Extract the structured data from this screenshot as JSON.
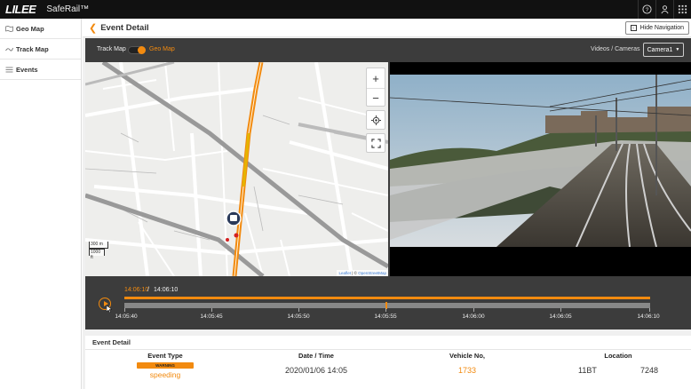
{
  "app": {
    "logo": "LILEE",
    "name": "SafeRail™"
  },
  "sidebar": {
    "items": [
      {
        "label": "Geo Map",
        "icon": "map-icon"
      },
      {
        "label": "Track Map",
        "icon": "route-icon"
      },
      {
        "label": "Events",
        "icon": "list-icon"
      }
    ]
  },
  "header": {
    "title": "Event Detail",
    "back_icon": "chevron-left-icon",
    "hide_nav_label": "Hide Navigation"
  },
  "controls": {
    "track_map_label": "Track Map",
    "geo_map_label": "Geo Map",
    "geo_map_enabled": true,
    "videos_label": "Videos / Cameras",
    "camera_selected": "Camera1"
  },
  "map": {
    "zoom_in": "+",
    "zoom_out": "−",
    "scale_m": "300 m",
    "scale_ft": "1000 ft",
    "attribution_leaflet": "Leaflet",
    "attribution_sep": " | © ",
    "attribution_osm": "OpenStreetMap"
  },
  "timeline": {
    "current": "14:06:10",
    "separator": " / ",
    "total": "14:06:10",
    "labels": [
      "14:05:40",
      "14:05:45",
      "14:05:50",
      "14:05:55",
      "14:06:00",
      "14:06:05",
      "14:06:10"
    ]
  },
  "event": {
    "section_title": "Event Detail",
    "type_header": "Event Type",
    "severity": "WARNING",
    "type_value": "speeding",
    "datetime_header": "Date / Time",
    "datetime_value": "2020/01/06 14:05",
    "vehicle_header": "Vehicle No,",
    "vehicle_value": "1733",
    "location_header": "Location",
    "location_line": "11BT",
    "location_value": "7248"
  },
  "colors": {
    "accent": "#f28a0f",
    "topbar": "#111111",
    "panel": "#3c3c3c"
  }
}
